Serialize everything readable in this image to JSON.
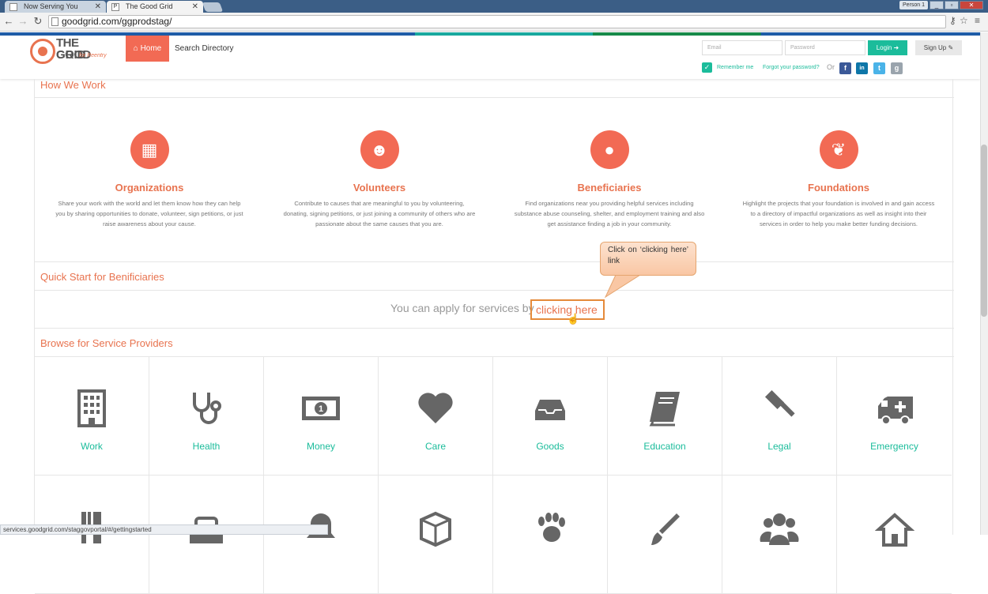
{
  "browser": {
    "tabs": [
      {
        "title": "Now Serving You"
      },
      {
        "title": "The Good Grid"
      }
    ],
    "person": "Person 1",
    "url": "goodgrid.com/ggprodstag/",
    "status_url": "services.goodgrid.com/staggovportal/#/gettingstarted"
  },
  "header": {
    "logo": {
      "line1": "THE GOOD",
      "line2": "GRID",
      "tagline": "for Reentry"
    },
    "nav": {
      "home": "Home",
      "search_directory": "Search Directory"
    },
    "login": {
      "email_placeholder": "Email",
      "password_placeholder": "Password",
      "login_label": "Login",
      "signup_label": "Sign Up",
      "remember_label": "Remember me",
      "forgot_label": "Forgot your password?",
      "or_label": "Or"
    },
    "social": [
      "f",
      "in",
      "t",
      "g"
    ]
  },
  "how_we_work": {
    "title": "How We Work",
    "items": [
      {
        "icon": "building-icon",
        "title": "Organizations",
        "desc": "Share your work with the world and let them know how they can help you by sharing opportunities to donate, volunteer, sign petitions, or just raise awareness about your cause."
      },
      {
        "icon": "group-icon",
        "title": "Volunteers",
        "desc": "Contribute to causes that are meaningful to you by volunteering, donating, signing petitions, or just joining a community of others who are passionate about the same causes that you are."
      },
      {
        "icon": "user-icon",
        "title": "Beneficiaries",
        "desc": "Find organizations near you providing helpful services including substance abuse counseling, shelter, and employment training and also get assistance finding a job in your community."
      },
      {
        "icon": "leaf-icon",
        "title": "Foundations",
        "desc": "Highlight the projects that your foundation is involved in and gain access to a directory of impactful organizations as well as insight into their services in order to help you make better funding decisions."
      }
    ]
  },
  "quick_start": {
    "title": "Quick Start for Benificiaries",
    "text": "You can apply for services by",
    "link": "clicking here"
  },
  "callout": "Click on ‘clicking here’ link",
  "browse": {
    "title": "Browse for Service Providers",
    "categories": [
      {
        "label": "Work",
        "icon": "building-icon"
      },
      {
        "label": "Health",
        "icon": "stethoscope-icon"
      },
      {
        "label": "Money",
        "icon": "money-icon"
      },
      {
        "label": "Care",
        "icon": "heart-icon"
      },
      {
        "label": "Goods",
        "icon": "inbox-icon"
      },
      {
        "label": "Education",
        "icon": "book-icon"
      },
      {
        "label": "Legal",
        "icon": "gavel-icon"
      },
      {
        "label": "Emergency",
        "icon": "ambulance-icon"
      }
    ],
    "row2_icons": [
      "food-icon",
      "basket-icon",
      "bell-icon",
      "cube-icon",
      "paw-icon",
      "brush-icon",
      "group-icon",
      "home-icon"
    ]
  },
  "colors": {
    "accent": "#f26a54",
    "teal": "#1bbc9b",
    "title": "#e8734f",
    "icon_gray": "#666666"
  }
}
